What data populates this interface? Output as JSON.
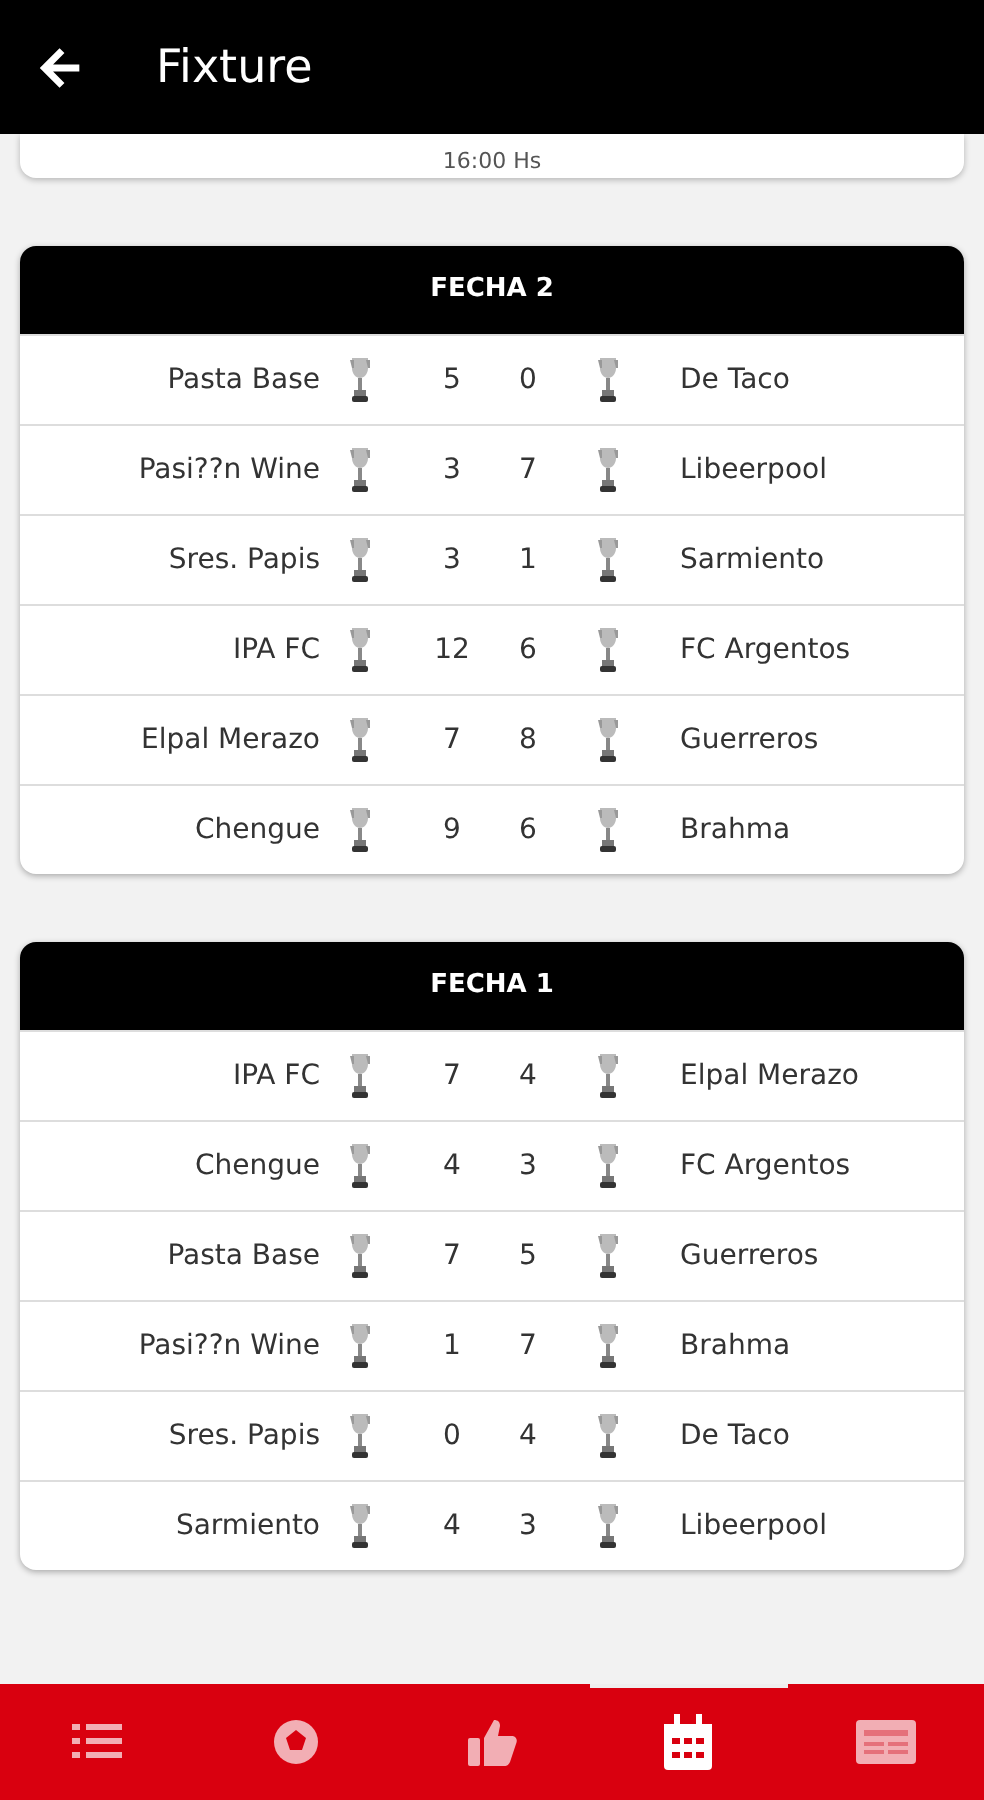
{
  "app_bar": {
    "title": "Fixture"
  },
  "partial_card": {
    "time": "16:00 Hs"
  },
  "rounds": [
    {
      "title": "FECHA 2",
      "matches": [
        {
          "home": "Pasta Base",
          "home_score": "5",
          "away_score": "0",
          "away": "De Taco"
        },
        {
          "home": "Pasi??n Wine",
          "home_score": "3",
          "away_score": "7",
          "away": "Libeerpool"
        },
        {
          "home": "Sres. Papis",
          "home_score": "3",
          "away_score": "1",
          "away": "Sarmiento"
        },
        {
          "home": "IPA FC",
          "home_score": "12",
          "away_score": "6",
          "away": "FC Argentos"
        },
        {
          "home": "Elpal Merazo",
          "home_score": "7",
          "away_score": "8",
          "away": "Guerreros"
        },
        {
          "home": "Chengue",
          "home_score": "9",
          "away_score": "6",
          "away": "Brahma"
        }
      ]
    },
    {
      "title": "FECHA 1",
      "matches": [
        {
          "home": "IPA FC",
          "home_score": "7",
          "away_score": "4",
          "away": "Elpal Merazo"
        },
        {
          "home": "Chengue",
          "home_score": "4",
          "away_score": "3",
          "away": "FC Argentos"
        },
        {
          "home": "Pasta Base",
          "home_score": "7",
          "away_score": "5",
          "away": "Guerreros"
        },
        {
          "home": "Pasi??n Wine",
          "home_score": "1",
          "away_score": "7",
          "away": "Brahma"
        },
        {
          "home": "Sres. Papis",
          "home_score": "0",
          "away_score": "4",
          "away": "De Taco"
        },
        {
          "home": "Sarmiento",
          "home_score": "4",
          "away_score": "3",
          "away": "Libeerpool"
        }
      ]
    }
  ],
  "nav": [
    {
      "kind": "list",
      "selected": false
    },
    {
      "kind": "ball",
      "selected": false
    },
    {
      "kind": "thumb",
      "selected": false
    },
    {
      "kind": "calendar",
      "selected": true
    },
    {
      "kind": "card",
      "selected": false
    }
  ]
}
